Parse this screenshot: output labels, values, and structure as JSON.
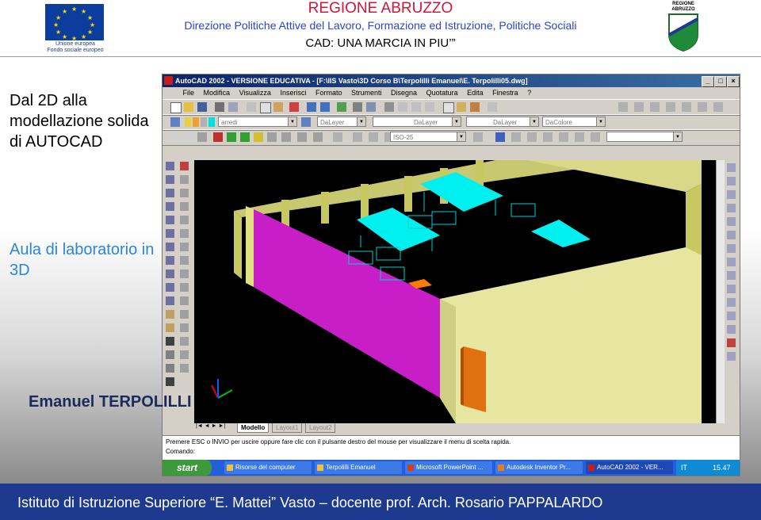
{
  "header": {
    "region": "REGIONE ABRUZZO",
    "department": "Direzione Politiche Attive del Lavoro, Formazione ed Istruzione, Politiche Sociali",
    "course": "CAD: UNA MARCIA IN PIU’”",
    "eu_caption_1": "Unione europea",
    "eu_caption_2": "Fondo sociale europeo",
    "logo_text": "REGIONE ABRUZZO"
  },
  "slide": {
    "title": "Dal 2D alla modellazione solida di AUTOCAD",
    "subtitle": "Aula di laboratorio in 3D",
    "author": "Emanuel TERPOLILLI"
  },
  "acad": {
    "title": "AutoCAD 2002 - VERSIONE EDUCATIVA - [F:\\IIS Vasto\\3D Corso B\\Terpolilli Emanuel\\E. Terpolilli05.dwg]",
    "menu": [
      "File",
      "Modifica",
      "Visualizza",
      "Inserisci",
      "Formato",
      "Strumenti",
      "Disegna",
      "Quotatura",
      "Edita",
      "Finestra",
      "?"
    ],
    "layer_value": "arredi",
    "bylayer_1": "DaLayer",
    "bylayer_2": "DaLayer",
    "bylayer_3": "DaLayer",
    "color_value": "DaColore",
    "dimstyle": "ISO-25",
    "tabs": [
      "Modello",
      "Layout1",
      "Layout2"
    ],
    "cmd_line": "Premere ESC o INVIO per uscire oppure fare clic con il pulsante destro del mouse per visualizzare il menu di scelta rapida.",
    "cmd_prompt": "Comando:"
  },
  "taskbar": {
    "start": "start",
    "items": [
      "Risorse del computer",
      "Terpolilli Emanuel",
      "Microsoft PowerPoint ...",
      "Autodesk Inventor Pr...",
      "AutoCAD 2002 - VER..."
    ],
    "lang": "IT",
    "clock": "15.47"
  },
  "footer": {
    "text": "Istituto di Istruzione Superiore “E. Mattei” Vasto – docente prof. Arch. Rosario PAPPALARDO"
  }
}
